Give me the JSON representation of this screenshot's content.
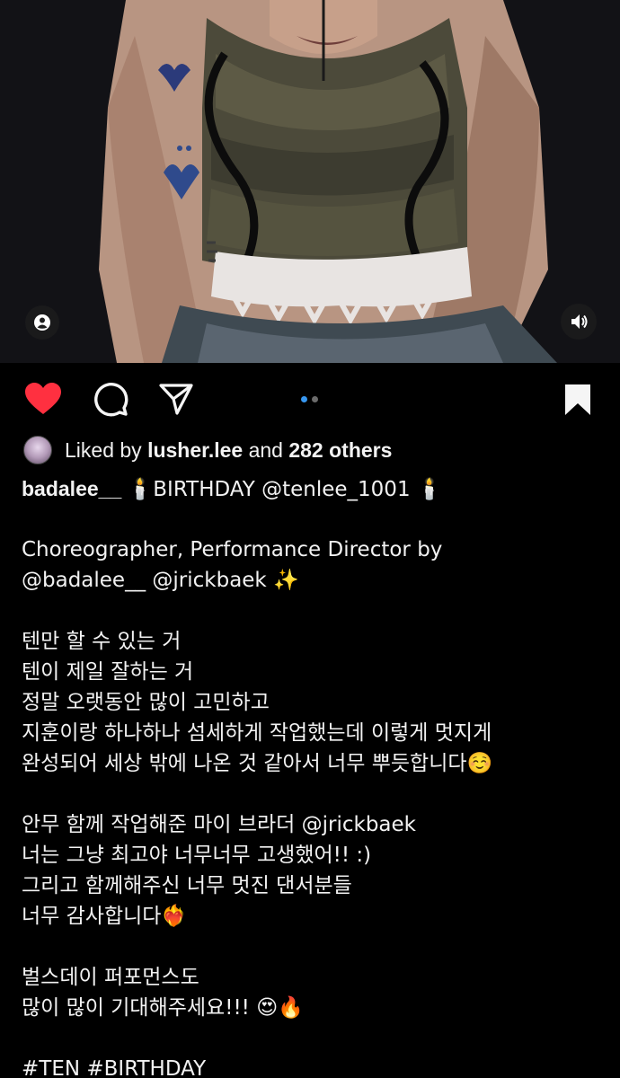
{
  "post": {
    "likes": {
      "prefix": "Liked by",
      "user": "lusher.lee",
      "joiner": "and",
      "others": "282 others"
    },
    "caption": {
      "username": "badalee__",
      "first_line": "🕯️BIRTHDAY @tenlee_1001 🕯️",
      "lines": [
        "",
        "Choreographer, Performance Director by",
        "@badalee__ @jrickbaek ✨",
        "",
        "텐만 할 수 있는 거",
        "텐이 제일 잘하는 거",
        "정말 오랫동안 많이 고민하고",
        "지훈이랑 하나하나 섬세하게 작업했는데 이렇게 멋지게",
        "완성되어 세상 밖에 나온 것 같아서 너무 뿌듯합니다☺️",
        "",
        "안무 함께 작업해준 마이 브라더 @jrickbaek",
        "너는 그냥 최고야 너무너무 고생했어!! :)",
        "그리고 함께해주신 너무 멋진 댄서분들",
        "너무 감사합니다❤️‍🔥",
        "",
        "벌스데이 퍼포먼스도",
        "많이 많이 기대해주세요!!! 😍🔥",
        "",
        "#TEN #BIRTHDAY"
      ]
    },
    "carousel": {
      "count": 2,
      "active": 0
    }
  },
  "icons": {
    "like": "heart-filled-icon",
    "comment": "comment-bubble-icon",
    "share": "paper-plane-icon",
    "save": "bookmark-filled-icon",
    "tag": "user-tag-icon",
    "sound": "speaker-icon"
  },
  "colors": {
    "background": "#000000",
    "like": "#ff3040",
    "carousel_active": "#3797f0",
    "text": "#f5f5f5"
  }
}
